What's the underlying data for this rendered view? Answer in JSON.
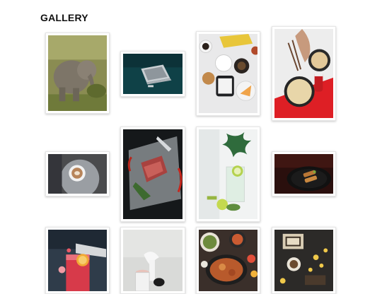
{
  "page": {
    "title": "GALLERY"
  },
  "gallery": {
    "photos": [
      {
        "subject": "elephant"
      },
      {
        "subject": "laptop"
      },
      {
        "subject": "coffee-table-flatlay"
      },
      {
        "subject": "noodles-bowl"
      },
      {
        "subject": "latte-art"
      },
      {
        "subject": "raw-steak-on-ice"
      },
      {
        "subject": "drink-with-lime"
      },
      {
        "subject": "plated-dish"
      },
      {
        "subject": "red-cocktail"
      },
      {
        "subject": "cream-pour"
      },
      {
        "subject": "food-spread"
      },
      {
        "subject": "dessert-box"
      }
    ]
  }
}
